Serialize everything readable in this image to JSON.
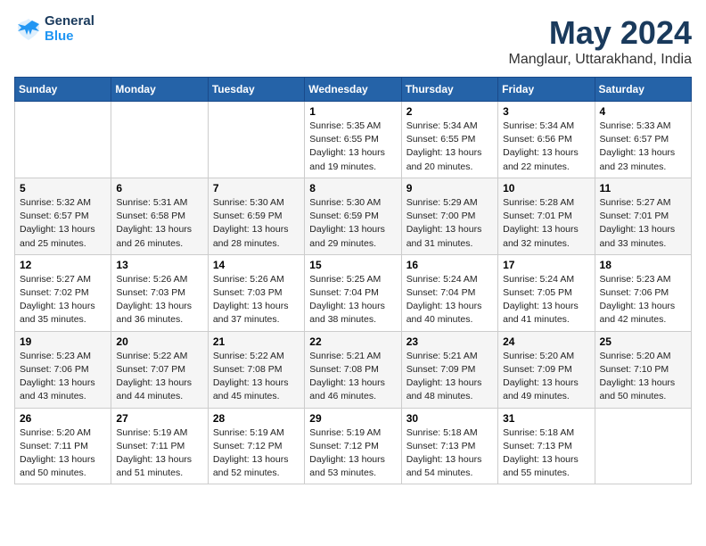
{
  "header": {
    "logo_line1": "General",
    "logo_line2": "Blue",
    "month": "May 2024",
    "location": "Manglaur, Uttarakhand, India"
  },
  "weekdays": [
    "Sunday",
    "Monday",
    "Tuesday",
    "Wednesday",
    "Thursday",
    "Friday",
    "Saturday"
  ],
  "weeks": [
    [
      {
        "day": "",
        "sunrise": "",
        "sunset": "",
        "daylight": ""
      },
      {
        "day": "",
        "sunrise": "",
        "sunset": "",
        "daylight": ""
      },
      {
        "day": "",
        "sunrise": "",
        "sunset": "",
        "daylight": ""
      },
      {
        "day": "1",
        "sunrise": "Sunrise: 5:35 AM",
        "sunset": "Sunset: 6:55 PM",
        "daylight": "Daylight: 13 hours and 19 minutes."
      },
      {
        "day": "2",
        "sunrise": "Sunrise: 5:34 AM",
        "sunset": "Sunset: 6:55 PM",
        "daylight": "Daylight: 13 hours and 20 minutes."
      },
      {
        "day": "3",
        "sunrise": "Sunrise: 5:34 AM",
        "sunset": "Sunset: 6:56 PM",
        "daylight": "Daylight: 13 hours and 22 minutes."
      },
      {
        "day": "4",
        "sunrise": "Sunrise: 5:33 AM",
        "sunset": "Sunset: 6:57 PM",
        "daylight": "Daylight: 13 hours and 23 minutes."
      }
    ],
    [
      {
        "day": "5",
        "sunrise": "Sunrise: 5:32 AM",
        "sunset": "Sunset: 6:57 PM",
        "daylight": "Daylight: 13 hours and 25 minutes."
      },
      {
        "day": "6",
        "sunrise": "Sunrise: 5:31 AM",
        "sunset": "Sunset: 6:58 PM",
        "daylight": "Daylight: 13 hours and 26 minutes."
      },
      {
        "day": "7",
        "sunrise": "Sunrise: 5:30 AM",
        "sunset": "Sunset: 6:59 PM",
        "daylight": "Daylight: 13 hours and 28 minutes."
      },
      {
        "day": "8",
        "sunrise": "Sunrise: 5:30 AM",
        "sunset": "Sunset: 6:59 PM",
        "daylight": "Daylight: 13 hours and 29 minutes."
      },
      {
        "day": "9",
        "sunrise": "Sunrise: 5:29 AM",
        "sunset": "Sunset: 7:00 PM",
        "daylight": "Daylight: 13 hours and 31 minutes."
      },
      {
        "day": "10",
        "sunrise": "Sunrise: 5:28 AM",
        "sunset": "Sunset: 7:01 PM",
        "daylight": "Daylight: 13 hours and 32 minutes."
      },
      {
        "day": "11",
        "sunrise": "Sunrise: 5:27 AM",
        "sunset": "Sunset: 7:01 PM",
        "daylight": "Daylight: 13 hours and 33 minutes."
      }
    ],
    [
      {
        "day": "12",
        "sunrise": "Sunrise: 5:27 AM",
        "sunset": "Sunset: 7:02 PM",
        "daylight": "Daylight: 13 hours and 35 minutes."
      },
      {
        "day": "13",
        "sunrise": "Sunrise: 5:26 AM",
        "sunset": "Sunset: 7:03 PM",
        "daylight": "Daylight: 13 hours and 36 minutes."
      },
      {
        "day": "14",
        "sunrise": "Sunrise: 5:26 AM",
        "sunset": "Sunset: 7:03 PM",
        "daylight": "Daylight: 13 hours and 37 minutes."
      },
      {
        "day": "15",
        "sunrise": "Sunrise: 5:25 AM",
        "sunset": "Sunset: 7:04 PM",
        "daylight": "Daylight: 13 hours and 38 minutes."
      },
      {
        "day": "16",
        "sunrise": "Sunrise: 5:24 AM",
        "sunset": "Sunset: 7:04 PM",
        "daylight": "Daylight: 13 hours and 40 minutes."
      },
      {
        "day": "17",
        "sunrise": "Sunrise: 5:24 AM",
        "sunset": "Sunset: 7:05 PM",
        "daylight": "Daylight: 13 hours and 41 minutes."
      },
      {
        "day": "18",
        "sunrise": "Sunrise: 5:23 AM",
        "sunset": "Sunset: 7:06 PM",
        "daylight": "Daylight: 13 hours and 42 minutes."
      }
    ],
    [
      {
        "day": "19",
        "sunrise": "Sunrise: 5:23 AM",
        "sunset": "Sunset: 7:06 PM",
        "daylight": "Daylight: 13 hours and 43 minutes."
      },
      {
        "day": "20",
        "sunrise": "Sunrise: 5:22 AM",
        "sunset": "Sunset: 7:07 PM",
        "daylight": "Daylight: 13 hours and 44 minutes."
      },
      {
        "day": "21",
        "sunrise": "Sunrise: 5:22 AM",
        "sunset": "Sunset: 7:08 PM",
        "daylight": "Daylight: 13 hours and 45 minutes."
      },
      {
        "day": "22",
        "sunrise": "Sunrise: 5:21 AM",
        "sunset": "Sunset: 7:08 PM",
        "daylight": "Daylight: 13 hours and 46 minutes."
      },
      {
        "day": "23",
        "sunrise": "Sunrise: 5:21 AM",
        "sunset": "Sunset: 7:09 PM",
        "daylight": "Daylight: 13 hours and 48 minutes."
      },
      {
        "day": "24",
        "sunrise": "Sunrise: 5:20 AM",
        "sunset": "Sunset: 7:09 PM",
        "daylight": "Daylight: 13 hours and 49 minutes."
      },
      {
        "day": "25",
        "sunrise": "Sunrise: 5:20 AM",
        "sunset": "Sunset: 7:10 PM",
        "daylight": "Daylight: 13 hours and 50 minutes."
      }
    ],
    [
      {
        "day": "26",
        "sunrise": "Sunrise: 5:20 AM",
        "sunset": "Sunset: 7:11 PM",
        "daylight": "Daylight: 13 hours and 50 minutes."
      },
      {
        "day": "27",
        "sunrise": "Sunrise: 5:19 AM",
        "sunset": "Sunset: 7:11 PM",
        "daylight": "Daylight: 13 hours and 51 minutes."
      },
      {
        "day": "28",
        "sunrise": "Sunrise: 5:19 AM",
        "sunset": "Sunset: 7:12 PM",
        "daylight": "Daylight: 13 hours and 52 minutes."
      },
      {
        "day": "29",
        "sunrise": "Sunrise: 5:19 AM",
        "sunset": "Sunset: 7:12 PM",
        "daylight": "Daylight: 13 hours and 53 minutes."
      },
      {
        "day": "30",
        "sunrise": "Sunrise: 5:18 AM",
        "sunset": "Sunset: 7:13 PM",
        "daylight": "Daylight: 13 hours and 54 minutes."
      },
      {
        "day": "31",
        "sunrise": "Sunrise: 5:18 AM",
        "sunset": "Sunset: 7:13 PM",
        "daylight": "Daylight: 13 hours and 55 minutes."
      },
      {
        "day": "",
        "sunrise": "",
        "sunset": "",
        "daylight": ""
      }
    ]
  ]
}
